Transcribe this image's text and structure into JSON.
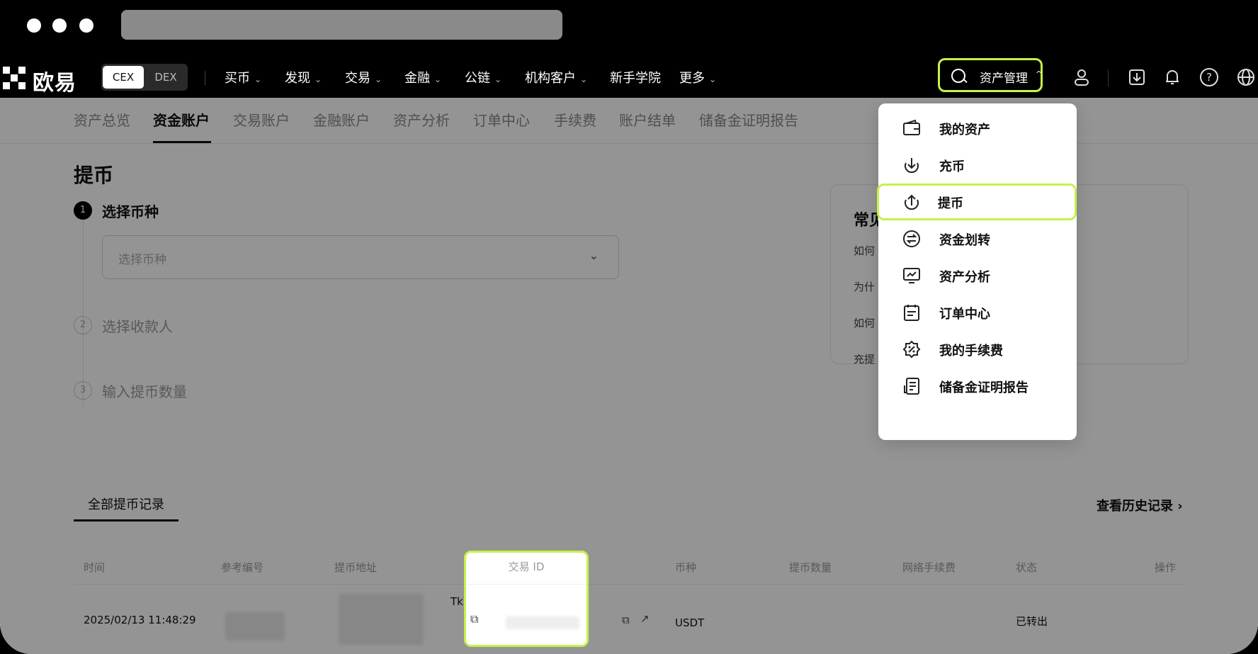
{
  "window": {
    "dots": 3
  },
  "topnav": {
    "logo": "欧易",
    "cex_label": "CEX",
    "dex_label": "DEX",
    "items": [
      {
        "label": "买币",
        "dropdown": true
      },
      {
        "label": "发现",
        "dropdown": true
      },
      {
        "label": "交易",
        "dropdown": true
      },
      {
        "label": "金融",
        "dropdown": true
      },
      {
        "label": "公链",
        "dropdown": true
      },
      {
        "label": "机构客户",
        "dropdown": true
      },
      {
        "label": "新手学院",
        "dropdown": false
      },
      {
        "label": "更多",
        "dropdown": true
      }
    ],
    "search_label": "资产管理",
    "icons": [
      "user-icon",
      "download-icon",
      "bell-icon",
      "help-icon",
      "globe-icon"
    ]
  },
  "subnav": {
    "items": [
      "资产总览",
      "资金账户",
      "交易账户",
      "金融账户",
      "资产分析",
      "订单中心",
      "手续费",
      "账户结单",
      "储备金证明报告"
    ],
    "active": "资金账户"
  },
  "main": {
    "title": "提币",
    "steps": [
      {
        "num": "1",
        "label": "选择币种"
      },
      {
        "num": "2",
        "label": "选择收款人"
      },
      {
        "num": "3",
        "label": "输入提币数量"
      }
    ],
    "select_placeholder": "选择币种"
  },
  "faq": {
    "title": "常见",
    "questions": [
      "如何",
      "为什",
      "如何",
      "充提"
    ]
  },
  "records": {
    "tab": "全部提币记录",
    "history_link": "查看历史记录",
    "columns": [
      "时间",
      "参考编号",
      "提币地址",
      "交易 ID",
      "币种",
      "提币数量",
      "网络手续费",
      "状态",
      "操作"
    ],
    "rows": [
      {
        "time": "2025/02/13 11:48:29",
        "address_prefix": "Tk",
        "coin": "USDT",
        "status": "已转出"
      }
    ]
  },
  "menu": {
    "items": [
      {
        "label": "我的资产",
        "icon": "wallet-icon"
      },
      {
        "label": "充币",
        "icon": "deposit-icon"
      },
      {
        "label": "提币",
        "icon": "withdraw-icon",
        "highlighted": true
      },
      {
        "label": "资金划转",
        "icon": "transfer-icon"
      },
      {
        "label": "资产分析",
        "icon": "analysis-icon"
      },
      {
        "label": "订单中心",
        "icon": "orders-icon"
      },
      {
        "label": "我的手续费",
        "icon": "fee-icon"
      },
      {
        "label": "储备金证明报告",
        "icon": "report-icon"
      }
    ]
  },
  "colors": {
    "highlight": "#c5f24a",
    "nav_bg": "#000000"
  }
}
